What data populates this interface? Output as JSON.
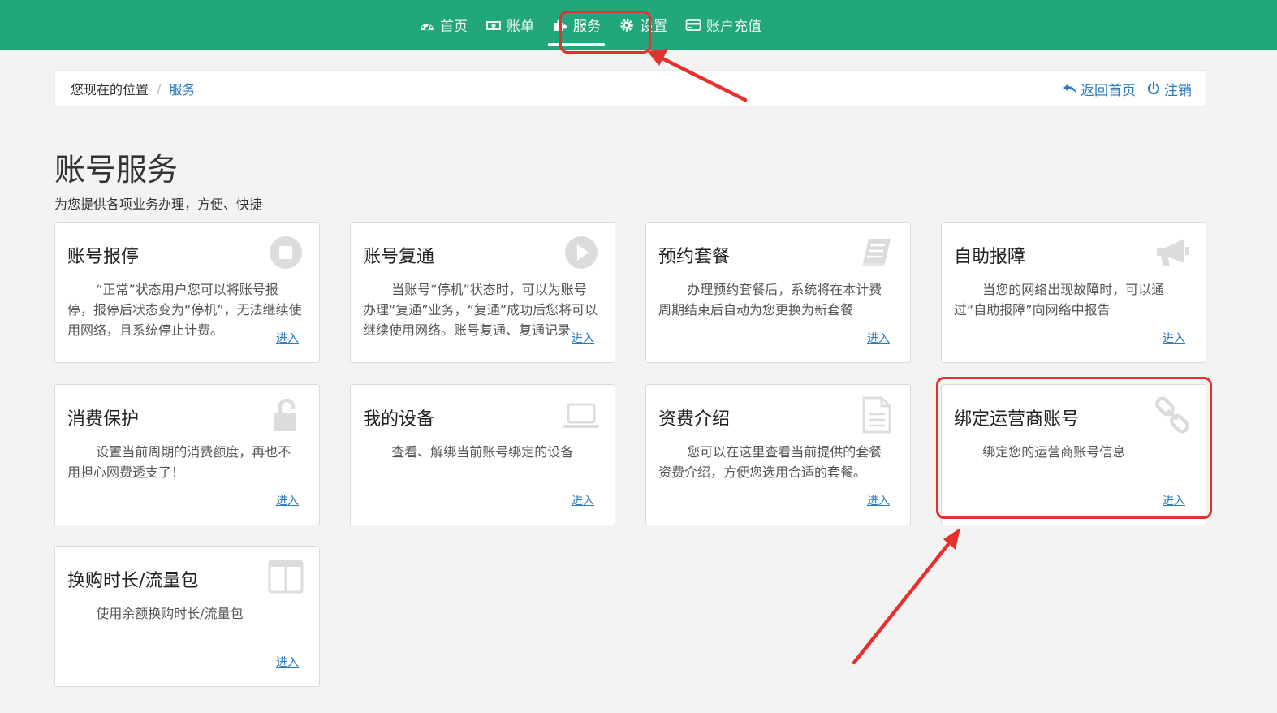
{
  "nav": {
    "items": [
      {
        "label": "首页",
        "icon": "dashboard-icon"
      },
      {
        "label": "账单",
        "icon": "money-icon"
      },
      {
        "label": "服务",
        "icon": "puzzle-icon"
      },
      {
        "label": "设置",
        "icon": "gear-icon"
      },
      {
        "label": "账户充值",
        "icon": "credit-card-icon"
      }
    ],
    "active": "服务"
  },
  "breadcrumb": {
    "prefix": "您现在的位置",
    "separator": "/",
    "current": "服务",
    "home_link": "返回首页",
    "logout_link": "注销"
  },
  "page": {
    "title": "账号服务",
    "subtitle": "为您提供各项业务办理，方便、快捷"
  },
  "cards": [
    {
      "title": "账号报停",
      "icon": "stop-circle-icon",
      "desc": "“正常”状态用户您可以将账号报停，报停后状态变为“停机”，无法继续使用网络，且系统停止计费。",
      "link": "进入"
    },
    {
      "title": "账号复通",
      "icon": "play-circle-icon",
      "desc": "当账号“停机”状态时，可以为账号办理“复通”业务，“复通”成功后您将可以继续使用网络。账号复通、复通记录",
      "link": "进入"
    },
    {
      "title": "预约套餐",
      "icon": "book-icon",
      "desc": "办理预约套餐后，系统将在本计费周期结束后自动为您更换为新套餐",
      "link": "进入"
    },
    {
      "title": "自助报障",
      "icon": "megaphone-icon",
      "desc": "当您的网络出现故障时，可以通过“自助报障”向网络中报告",
      "link": "进入"
    },
    {
      "title": "消费保护",
      "icon": "unlock-icon",
      "desc": "设置当前周期的消费额度，再也不用担心网费透支了！",
      "link": "进入"
    },
    {
      "title": "我的设备",
      "icon": "laptop-icon",
      "desc": "查看、解绑当前账号绑定的设备",
      "link": "进入"
    },
    {
      "title": "资费介绍",
      "icon": "document-icon",
      "desc": "您可以在这里查看当前提供的套餐资费介绍，方便您选用合适的套餐。",
      "link": "进入"
    },
    {
      "title": "绑定运营商账号",
      "icon": "link-icon",
      "desc": "绑定您的运营商账号信息",
      "link": "进入"
    },
    {
      "title": "换购时长/流量包",
      "icon": "columns-icon",
      "desc": "使用余额换购时长/流量包",
      "link": "进入"
    }
  ],
  "colors": {
    "header": "#22a67b",
    "link": "#2d7bbf",
    "annotation": "#e53030"
  }
}
